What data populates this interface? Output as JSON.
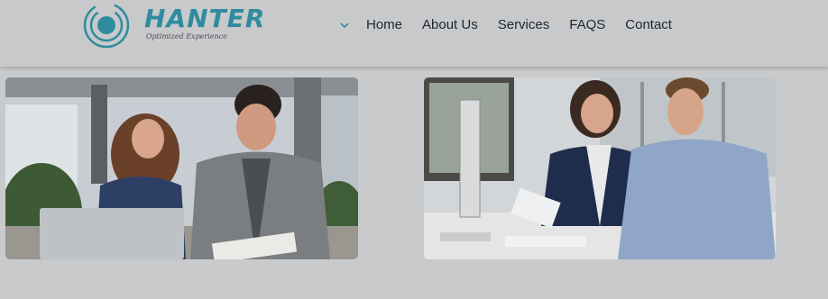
{
  "header": {
    "brand": "HANTER",
    "tagline": "Optimized Experience",
    "accent": "#2f8c9e"
  },
  "nav": {
    "dropdown_icon": "chevron-down-icon",
    "items": [
      "Home",
      "About Us",
      "Services",
      "FAQS",
      "Contact"
    ]
  },
  "images": {
    "left": "photo: woman and man reviewing documents at desk with laptop",
    "right": "photo: woman and man smiling at office desk with computer"
  }
}
